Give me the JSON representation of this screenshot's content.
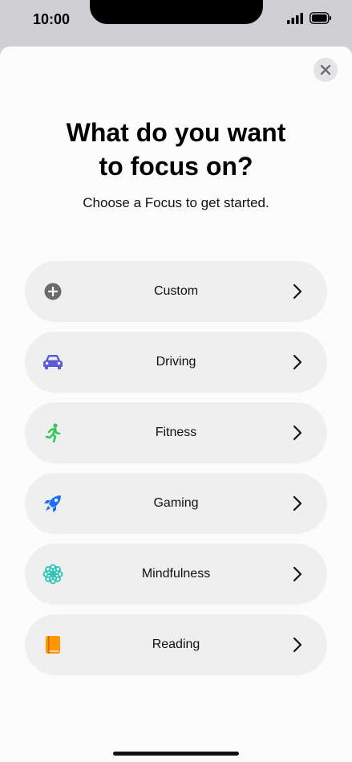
{
  "status_bar": {
    "time": "10:00",
    "signal_icon": "cellular-signal-icon",
    "battery_icon": "battery-icon"
  },
  "sheet": {
    "close_icon": "close-icon",
    "title_line1": "What do you want",
    "title_line2": "to focus on?",
    "subtitle": "Choose a Focus to get started."
  },
  "options": [
    {
      "label": "Custom",
      "icon": "plus-circle-icon",
      "color": "#6b6b6b"
    },
    {
      "label": "Driving",
      "icon": "car-icon",
      "color": "#5b5bd6"
    },
    {
      "label": "Fitness",
      "icon": "running-figure-icon",
      "color": "#34c759"
    },
    {
      "label": "Gaming",
      "icon": "rocket-icon",
      "color": "#1e6ff5"
    },
    {
      "label": "Mindfulness",
      "icon": "flower-icon",
      "color": "#2ec4b6"
    },
    {
      "label": "Reading",
      "icon": "book-icon",
      "color": "#ff9500"
    }
  ]
}
